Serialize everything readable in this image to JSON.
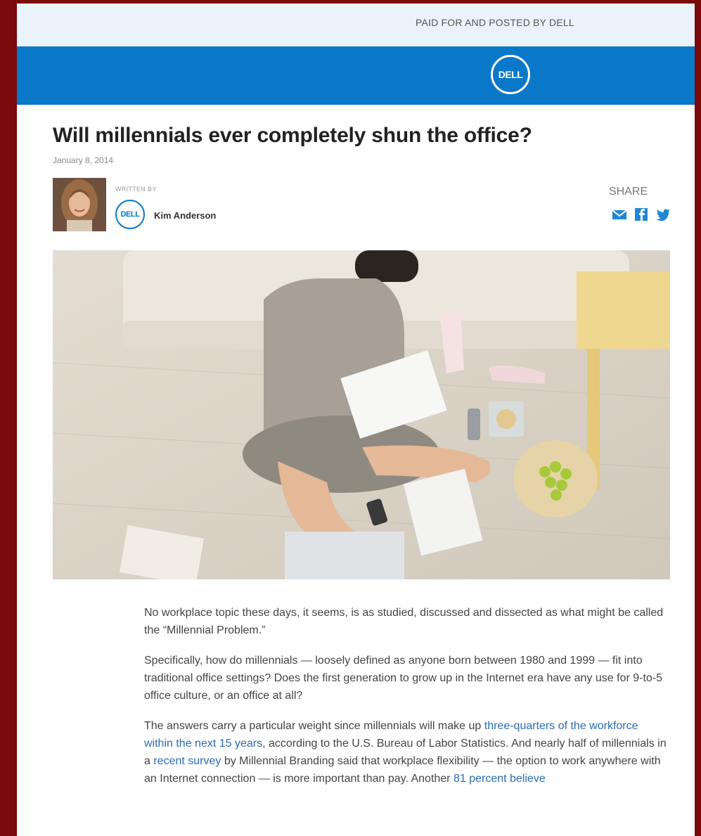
{
  "sponsor": {
    "text": "PAID FOR AND POSTED BY DELL"
  },
  "brand": {
    "logo_text": "DELL"
  },
  "article": {
    "title": "Will millennials ever completely shun the office?",
    "date": "January 8, 2014",
    "written_by_label": "WRITTEN BY:",
    "author_name": "Kim Anderson",
    "share_label": "SHARE",
    "paragraphs": [
      [
        {
          "text": "No workplace topic these days, it seems, is as studied, discussed and dissected as what might be called the “Millennial Problem.”"
        }
      ],
      [
        {
          "text": "Specifically, how do millennials — loosely defined as anyone born between 1980 and 1999 — fit into traditional office settings? Does the first generation to grow up in the Internet era have any use for 9-to-5 office culture, or an office at all?"
        }
      ],
      [
        {
          "text": "The answers carry a particular weight since millennials will make up "
        },
        {
          "text": "three-quarters of the workforce within the next 15 years",
          "link": true
        },
        {
          "text": ", according to the U.S. Bureau of Labor Statistics. And nearly half of millennials in a "
        },
        {
          "text": "recent survey",
          "link": true
        },
        {
          "text": " by Millennial Branding said that workplace flexibility — the option to work anywhere with an Internet connection — is more important than pay. Another "
        },
        {
          "text": "81 percent believe",
          "link": true
        }
      ]
    ]
  },
  "colors": {
    "brand_blue": "#0a78c8",
    "page_background": "#7a0a0c",
    "link": "#2b6cb0"
  },
  "icons": [
    "dell-logo",
    "mail-icon",
    "facebook-icon",
    "twitter-icon"
  ]
}
